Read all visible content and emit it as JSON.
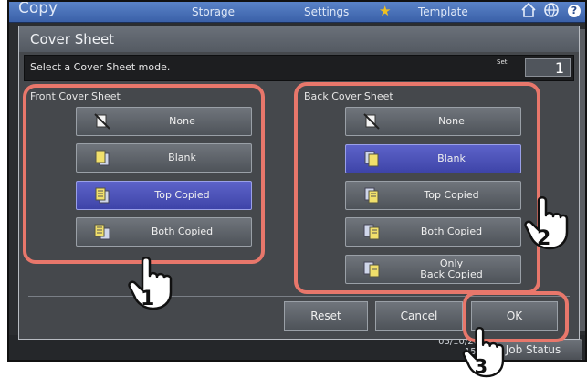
{
  "header": {
    "app_title": "Copy",
    "tabs": [
      "Storage",
      "Settings",
      "Template"
    ],
    "icons": [
      "star-icon",
      "home-icon",
      "globe-icon",
      "help-icon"
    ],
    "help_glyph": "?"
  },
  "footer": {
    "date": "03/10/20",
    "time": "15:",
    "job_status": "Job Status"
  },
  "dialog": {
    "title": "Cover Sheet",
    "message": "Select a Cover Sheet mode.",
    "set_label": "Set",
    "set_value": "1",
    "front": {
      "label": "Front Cover Sheet",
      "options": [
        "None",
        "Blank",
        "Top Copied",
        "Both Copied"
      ],
      "selected": "Top Copied"
    },
    "back": {
      "label": "Back Cover Sheet",
      "options": [
        "None",
        "Blank",
        "Top Copied",
        "Both Copied",
        "Only\nBack Copied"
      ],
      "selected": "Blank"
    },
    "buttons": {
      "reset": "Reset",
      "cancel": "Cancel",
      "ok": "OK"
    }
  },
  "callouts": [
    "1",
    "2",
    "3"
  ],
  "colors": {
    "selected": "#4a50b8",
    "callout": "#e8776b",
    "header_blue": "#4a72ba"
  }
}
